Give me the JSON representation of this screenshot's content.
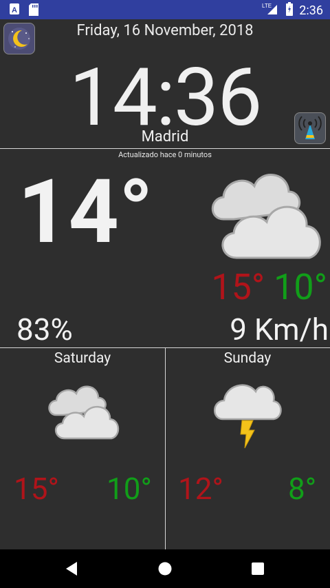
{
  "status_bar": {
    "time": "2:36",
    "network": "LTE",
    "icons": [
      "a-icon",
      "sd-card-icon",
      "signal-icon",
      "battery-icon"
    ]
  },
  "header": {
    "date": "Friday, 16 November, 2018",
    "time": "14:36",
    "city": "Madrid",
    "updated": "Actualizado hace 0 minutos"
  },
  "current": {
    "temp": "14°",
    "icon": "cloudy-icon",
    "high": "15°",
    "low": "10°",
    "humidity": "83%",
    "wind": "9 Km/h"
  },
  "forecast": [
    {
      "day": "Saturday",
      "icon": "cloudy-icon",
      "high": "15°",
      "low": "10°"
    },
    {
      "day": "Sunday",
      "icon": "thunderstorm-icon",
      "high": "12°",
      "low": "8°"
    }
  ],
  "colors": {
    "background": "#2e2e2e",
    "status_bar": "#303f9f",
    "high": "#b0141a",
    "low": "#119e19",
    "text": "#f2f2f2"
  }
}
